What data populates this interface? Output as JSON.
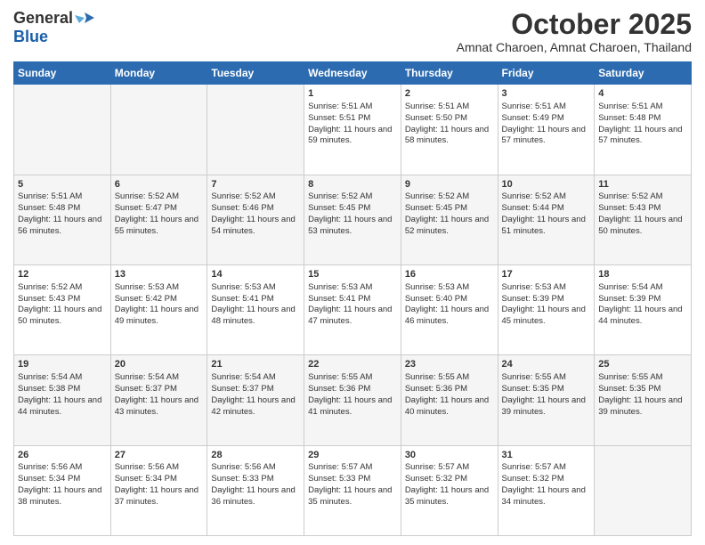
{
  "logo": {
    "general": "General",
    "blue": "Blue"
  },
  "title": "October 2025",
  "location": "Amnat Charoen, Amnat Charoen, Thailand",
  "weekdays": [
    "Sunday",
    "Monday",
    "Tuesday",
    "Wednesday",
    "Thursday",
    "Friday",
    "Saturday"
  ],
  "weeks": [
    [
      {
        "day": "",
        "text": ""
      },
      {
        "day": "",
        "text": ""
      },
      {
        "day": "",
        "text": ""
      },
      {
        "day": "1",
        "text": "Sunrise: 5:51 AM\nSunset: 5:51 PM\nDaylight: 11 hours and 59 minutes."
      },
      {
        "day": "2",
        "text": "Sunrise: 5:51 AM\nSunset: 5:50 PM\nDaylight: 11 hours and 58 minutes."
      },
      {
        "day": "3",
        "text": "Sunrise: 5:51 AM\nSunset: 5:49 PM\nDaylight: 11 hours and 57 minutes."
      },
      {
        "day": "4",
        "text": "Sunrise: 5:51 AM\nSunset: 5:48 PM\nDaylight: 11 hours and 57 minutes."
      }
    ],
    [
      {
        "day": "5",
        "text": "Sunrise: 5:51 AM\nSunset: 5:48 PM\nDaylight: 11 hours and 56 minutes."
      },
      {
        "day": "6",
        "text": "Sunrise: 5:52 AM\nSunset: 5:47 PM\nDaylight: 11 hours and 55 minutes."
      },
      {
        "day": "7",
        "text": "Sunrise: 5:52 AM\nSunset: 5:46 PM\nDaylight: 11 hours and 54 minutes."
      },
      {
        "day": "8",
        "text": "Sunrise: 5:52 AM\nSunset: 5:45 PM\nDaylight: 11 hours and 53 minutes."
      },
      {
        "day": "9",
        "text": "Sunrise: 5:52 AM\nSunset: 5:45 PM\nDaylight: 11 hours and 52 minutes."
      },
      {
        "day": "10",
        "text": "Sunrise: 5:52 AM\nSunset: 5:44 PM\nDaylight: 11 hours and 51 minutes."
      },
      {
        "day": "11",
        "text": "Sunrise: 5:52 AM\nSunset: 5:43 PM\nDaylight: 11 hours and 50 minutes."
      }
    ],
    [
      {
        "day": "12",
        "text": "Sunrise: 5:52 AM\nSunset: 5:43 PM\nDaylight: 11 hours and 50 minutes."
      },
      {
        "day": "13",
        "text": "Sunrise: 5:53 AM\nSunset: 5:42 PM\nDaylight: 11 hours and 49 minutes."
      },
      {
        "day": "14",
        "text": "Sunrise: 5:53 AM\nSunset: 5:41 PM\nDaylight: 11 hours and 48 minutes."
      },
      {
        "day": "15",
        "text": "Sunrise: 5:53 AM\nSunset: 5:41 PM\nDaylight: 11 hours and 47 minutes."
      },
      {
        "day": "16",
        "text": "Sunrise: 5:53 AM\nSunset: 5:40 PM\nDaylight: 11 hours and 46 minutes."
      },
      {
        "day": "17",
        "text": "Sunrise: 5:53 AM\nSunset: 5:39 PM\nDaylight: 11 hours and 45 minutes."
      },
      {
        "day": "18",
        "text": "Sunrise: 5:54 AM\nSunset: 5:39 PM\nDaylight: 11 hours and 44 minutes."
      }
    ],
    [
      {
        "day": "19",
        "text": "Sunrise: 5:54 AM\nSunset: 5:38 PM\nDaylight: 11 hours and 44 minutes."
      },
      {
        "day": "20",
        "text": "Sunrise: 5:54 AM\nSunset: 5:37 PM\nDaylight: 11 hours and 43 minutes."
      },
      {
        "day": "21",
        "text": "Sunrise: 5:54 AM\nSunset: 5:37 PM\nDaylight: 11 hours and 42 minutes."
      },
      {
        "day": "22",
        "text": "Sunrise: 5:55 AM\nSunset: 5:36 PM\nDaylight: 11 hours and 41 minutes."
      },
      {
        "day": "23",
        "text": "Sunrise: 5:55 AM\nSunset: 5:36 PM\nDaylight: 11 hours and 40 minutes."
      },
      {
        "day": "24",
        "text": "Sunrise: 5:55 AM\nSunset: 5:35 PM\nDaylight: 11 hours and 39 minutes."
      },
      {
        "day": "25",
        "text": "Sunrise: 5:55 AM\nSunset: 5:35 PM\nDaylight: 11 hours and 39 minutes."
      }
    ],
    [
      {
        "day": "26",
        "text": "Sunrise: 5:56 AM\nSunset: 5:34 PM\nDaylight: 11 hours and 38 minutes."
      },
      {
        "day": "27",
        "text": "Sunrise: 5:56 AM\nSunset: 5:34 PM\nDaylight: 11 hours and 37 minutes."
      },
      {
        "day": "28",
        "text": "Sunrise: 5:56 AM\nSunset: 5:33 PM\nDaylight: 11 hours and 36 minutes."
      },
      {
        "day": "29",
        "text": "Sunrise: 5:57 AM\nSunset: 5:33 PM\nDaylight: 11 hours and 35 minutes."
      },
      {
        "day": "30",
        "text": "Sunrise: 5:57 AM\nSunset: 5:32 PM\nDaylight: 11 hours and 35 minutes."
      },
      {
        "day": "31",
        "text": "Sunrise: 5:57 AM\nSunset: 5:32 PM\nDaylight: 11 hours and 34 minutes."
      },
      {
        "day": "",
        "text": ""
      }
    ]
  ]
}
